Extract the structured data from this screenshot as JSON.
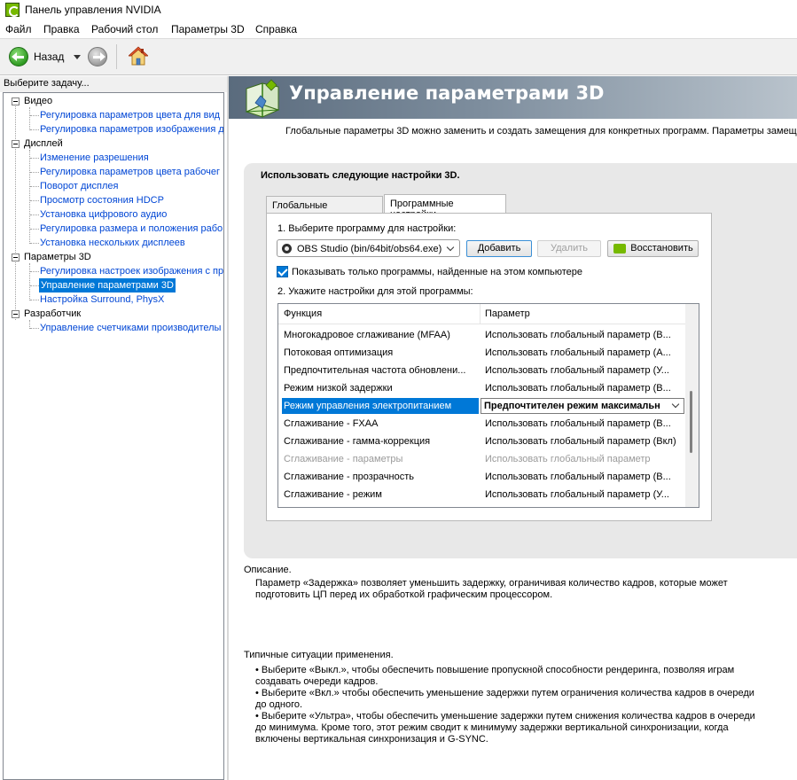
{
  "window": {
    "title": "Панель управления NVIDIA"
  },
  "menu": [
    "Файл",
    "Правка",
    "Рабочий стол",
    "Параметры 3D",
    "Справка"
  ],
  "toolbar": {
    "back_label": "Назад"
  },
  "left_pane": {
    "header": "Выберите задачу...",
    "categories": [
      {
        "label": "Видео",
        "items": [
          "Регулировка параметров цвета для вид",
          "Регулировка параметров изображения д"
        ]
      },
      {
        "label": "Дисплей",
        "items": [
          "Изменение разрешения",
          "Регулировка параметров цвета рабочег",
          "Поворот дисплея",
          "Просмотр состояния HDCP",
          "Установка цифрового аудио",
          "Регулировка размера и положения рабо",
          "Установка нескольких дисплеев"
        ]
      },
      {
        "label": "Параметры 3D",
        "items": [
          "Регулировка настроек изображения с пр",
          "Управление параметрами 3D",
          "Настройка Surround, PhysX"
        ]
      },
      {
        "label": "Разработчик",
        "items": [
          "Управление счетчиками производителы"
        ]
      }
    ],
    "selected_item": "Управление параметрами 3D"
  },
  "main": {
    "title": "Управление параметрами 3D",
    "intro": "Глобальные параметры 3D можно заменить и создать замещения для конкретных программ. Параметры замещ",
    "panel_title": "Использовать следующие настройки 3D.",
    "tabs": [
      "Глобальные параметры",
      "Программные настройки"
    ],
    "active_tab": "Программные настройки",
    "step1": "1. Выберите программу для настройки:",
    "program_select": "OBS Studio (bin/64bit/obs64.exe)",
    "add_button": "Добавить",
    "remove_button": "Удалить",
    "restore_button": "Восстановить",
    "checkbox_label": "Показывать только программы, найденные на этом компьютере",
    "checkbox_checked": true,
    "step2": "2. Укажите настройки для этой программы:",
    "grid": {
      "headers": [
        "Функция",
        "Параметр"
      ],
      "rows": [
        {
          "feature": "Многокадровое сглаживание (MFAA)",
          "value": "Использовать глобальный параметр (В...",
          "state": "normal"
        },
        {
          "feature": "Потоковая оптимизация",
          "value": "Использовать глобальный параметр (А...",
          "state": "normal"
        },
        {
          "feature": "Предпочтительная частота обновлени...",
          "value": "Использовать глобальный параметр (У...",
          "state": "normal"
        },
        {
          "feature": "Режим низкой задержки",
          "value": "Использовать глобальный параметр (В...",
          "state": "normal"
        },
        {
          "feature": "Режим управления электропитанием",
          "value": "Предпочтителен режим максимальн",
          "state": "selected"
        },
        {
          "feature": "Сглаживание - FXAA",
          "value": "Использовать глобальный параметр (В...",
          "state": "normal"
        },
        {
          "feature": "Сглаживание - гамма-коррекция",
          "value": "Использовать глобальный параметр (Вкл)",
          "state": "normal"
        },
        {
          "feature": "Сглаживание - параметры",
          "value": "Использовать глобальный параметр",
          "state": "dim"
        },
        {
          "feature": "Сглаживание - прозрачность",
          "value": "Использовать глобальный параметр (В...",
          "state": "normal"
        },
        {
          "feature": "Сглаживание - режим",
          "value": "Использовать глобальный параметр (У...",
          "state": "normal"
        }
      ]
    },
    "description_title": "Описание.",
    "description_lines": [
      "Параметр «Задержка» позволяет уменьшить задержку, ограничивая количество кадров, которые может",
      "подготовить ЦП перед их обработкой графическим процессором."
    ],
    "usage_title": "Типичные ситуации применения.",
    "usage_items": [
      [
        "•  Выберите «Выкл.», чтобы обеспечить повышение пропускной способности рендеринга, позволяя играм",
        "создавать очереди кадров."
      ],
      [
        "•  Выберите «Вкл.» чтобы обеспечить уменьшение задержки путем ограничения количества кадров в очереди",
        "до одного."
      ],
      [
        "•  Выберите «Ультра», чтобы обеспечить уменьшение задержки путем снижения количества кадров в очереди",
        "до минимума. Кроме того, этот режим сводит к минимуму задержки вертикальной синхронизации, когда",
        "включены вертикальная синхронизация и G-SYNC."
      ]
    ]
  }
}
